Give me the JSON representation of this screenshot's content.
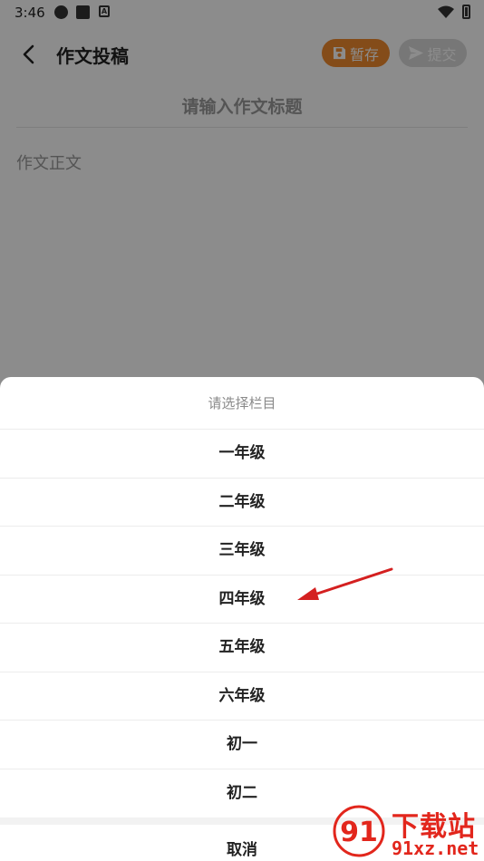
{
  "status_bar": {
    "time": "3:46",
    "badge_letter": "A"
  },
  "header": {
    "title": "作文投稿",
    "save_label": "暂存",
    "submit_label": "提交"
  },
  "form": {
    "title_placeholder": "请输入作文标题",
    "body_placeholder": "作文正文"
  },
  "sheet": {
    "title": "请选择栏目",
    "options": [
      "一年级",
      "二年级",
      "三年级",
      "四年级",
      "五年级",
      "六年级",
      "初一",
      "初二"
    ],
    "cancel_label": "取消"
  },
  "watermark": {
    "logo_text": "91",
    "name": "下载站",
    "domain": "91xz.net"
  },
  "colors": {
    "accent": "#f08a2e",
    "annotation_arrow": "#d42020",
    "watermark": "#e2261c"
  }
}
